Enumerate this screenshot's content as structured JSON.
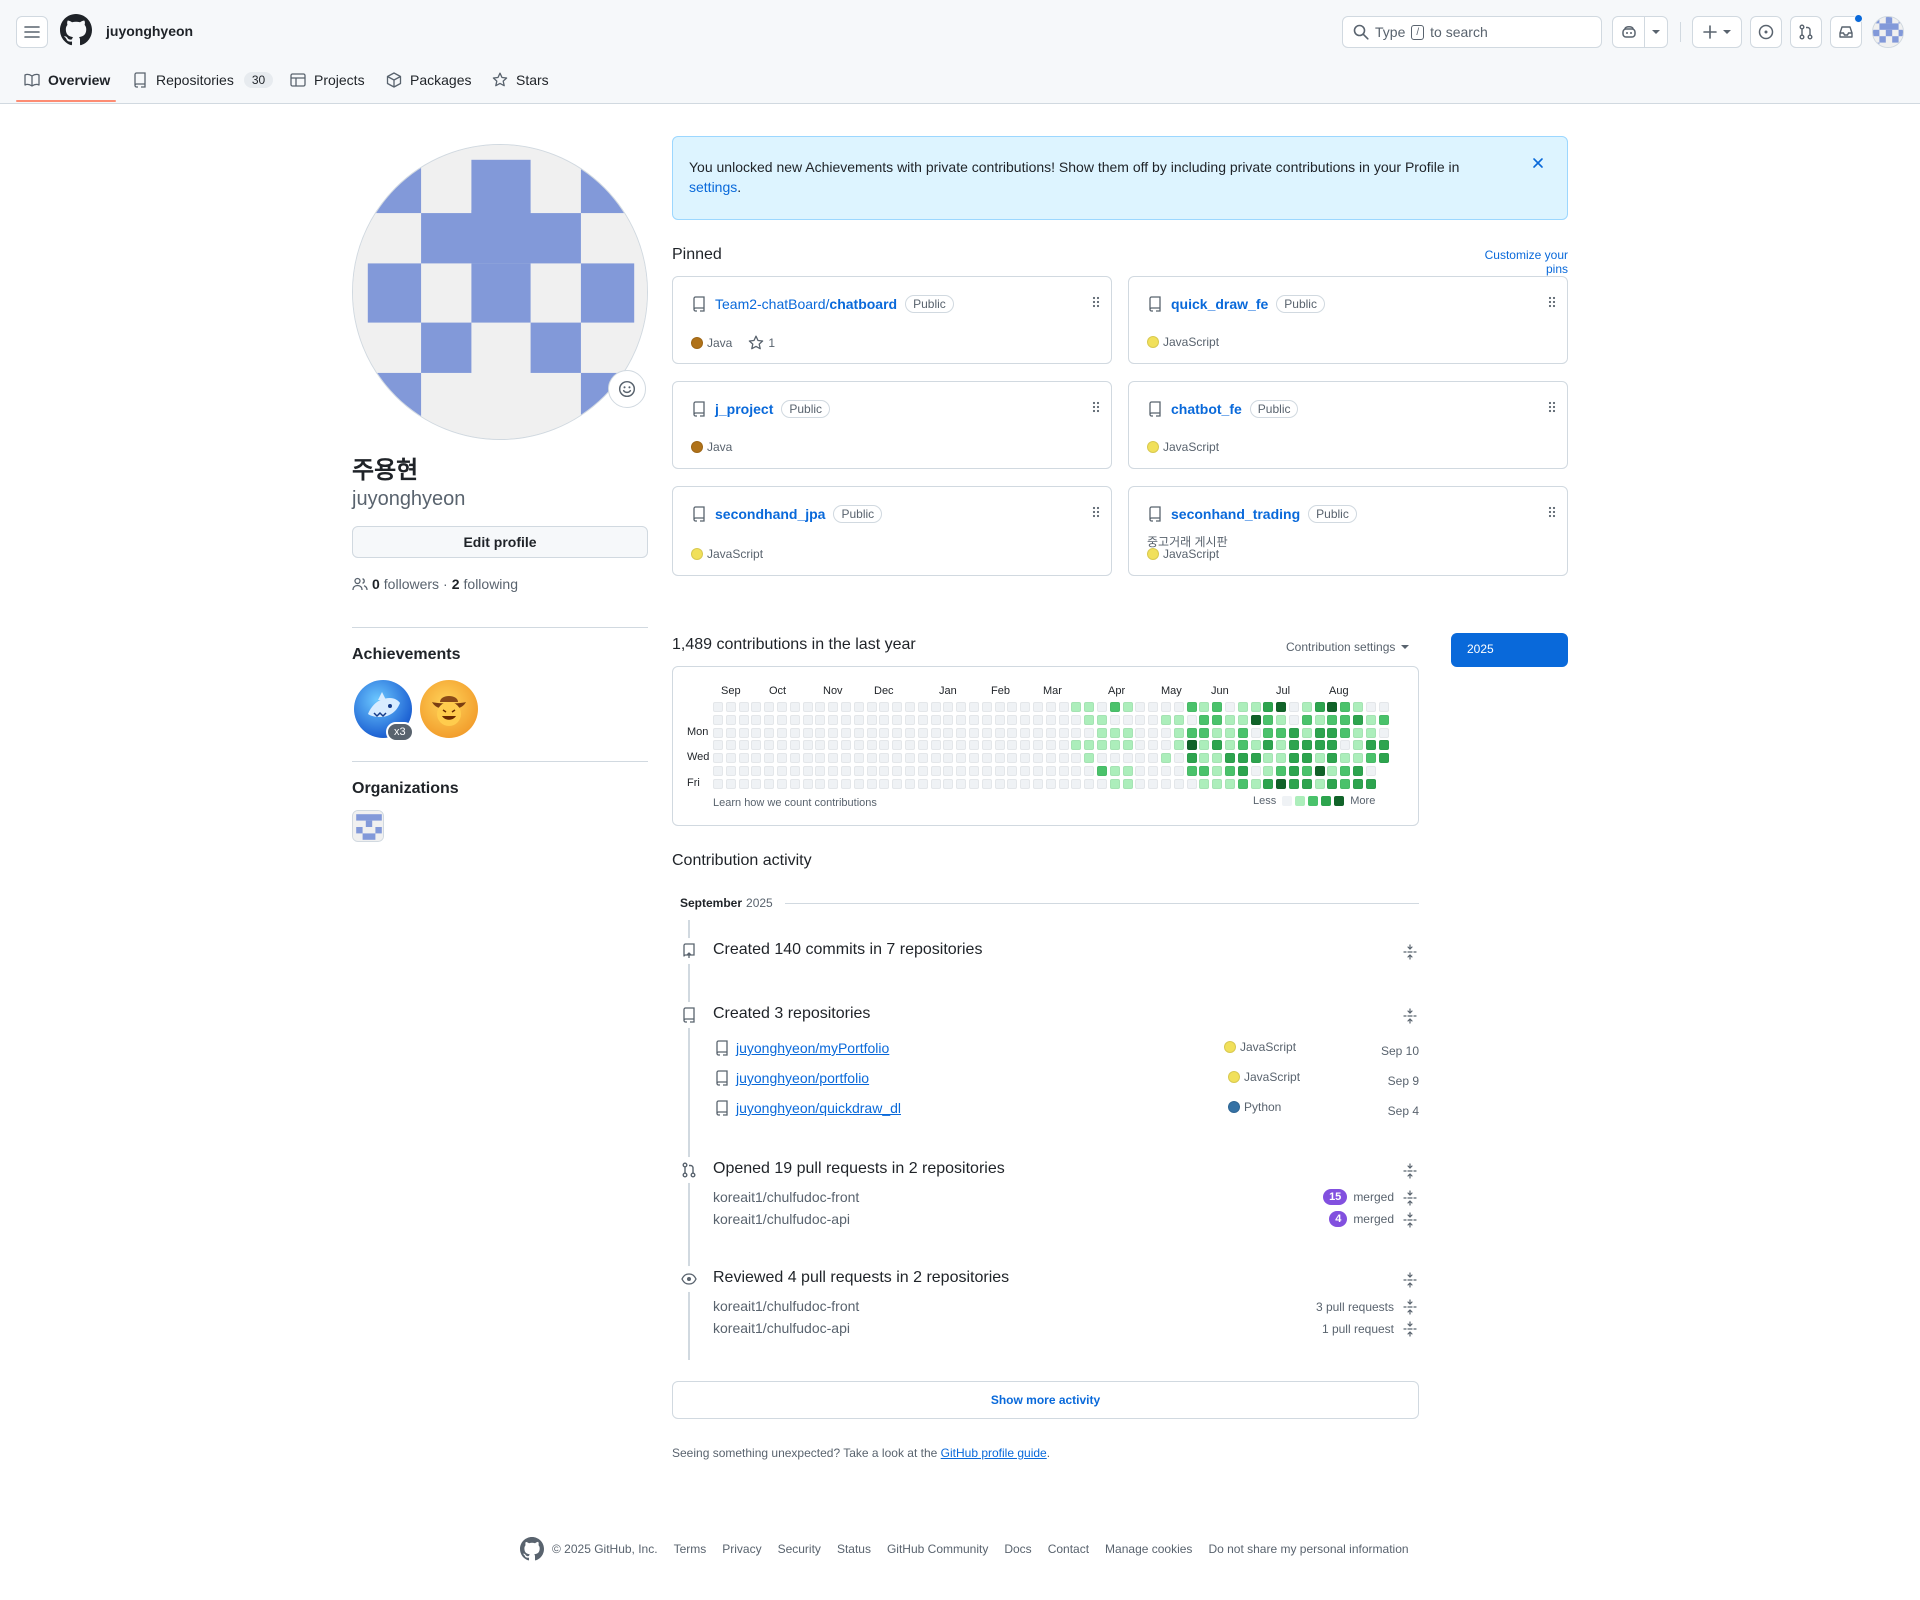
{
  "header": {
    "username": "juyonghyeon",
    "search_placeholder": "Type",
    "search_slash": "/",
    "search_suffix": "to search"
  },
  "tabs": [
    {
      "label": "Overview",
      "active": true
    },
    {
      "label": "Repositories",
      "count": "30"
    },
    {
      "label": "Projects"
    },
    {
      "label": "Packages"
    },
    {
      "label": "Stars"
    }
  ],
  "profile": {
    "display_name": "주용현",
    "username": "juyonghyeon",
    "edit_profile": "Edit profile",
    "followers_count": "0",
    "followers_label": "followers",
    "separator": "·",
    "following_count": "2",
    "following_label": "following",
    "achievements_title": "Achievements",
    "achievement_multiplier": "x3",
    "organizations_title": "Organizations",
    "avatar_color": "#8299d9"
  },
  "banner": {
    "text": "You unlocked new Achievements with private contributions! Show them off by including private contributions in your Profile in",
    "link": "settings",
    "end": "."
  },
  "pinned": {
    "title": "Pinned",
    "customize": "Customize your pins",
    "items": [
      {
        "owner": "Team2-chatBoard/",
        "name": "chatboard",
        "visibility": "Public",
        "description": "",
        "language": "Java",
        "language_color": "#b07219",
        "stars": "1"
      },
      {
        "owner": "",
        "name": "quick_draw_fe",
        "visibility": "Public",
        "description": "",
        "language": "JavaScript",
        "language_color": "#f1e05a",
        "stars": ""
      },
      {
        "owner": "",
        "name": "j_project",
        "visibility": "Public",
        "description": "",
        "language": "Java",
        "language_color": "#b07219",
        "stars": ""
      },
      {
        "owner": "",
        "name": "chatbot_fe",
        "visibility": "Public",
        "description": "",
        "language": "JavaScript",
        "language_color": "#f1e05a",
        "stars": ""
      },
      {
        "owner": "",
        "name": "secondhand_jpa",
        "visibility": "Public",
        "description": "",
        "language": "JavaScript",
        "language_color": "#f1e05a",
        "stars": ""
      },
      {
        "owner": "",
        "name": "seconhand_trading",
        "visibility": "Public",
        "description": "중고거래 게시판",
        "language": "JavaScript",
        "language_color": "#f1e05a",
        "stars": ""
      }
    ]
  },
  "contributions": {
    "title": "1,489 contributions in the last year",
    "settings_label": "Contribution settings",
    "year": "2025",
    "months": [
      "Sep",
      "Oct",
      "Nov",
      "Dec",
      "Jan",
      "Feb",
      "Mar",
      "Apr",
      "May",
      "Jun",
      "Jul",
      "Aug"
    ],
    "days": [
      "Mon",
      "Wed",
      "Fri"
    ],
    "learn_link": "Learn how we count contributions",
    "less": "Less",
    "more": "More",
    "colors": [
      "#eff2f5",
      "#aceebb",
      "#4ac26b",
      "#2da44e",
      "#116329"
    ]
  },
  "activity": {
    "title": "Contribution activity",
    "month": "September",
    "year": "2025",
    "commits_title": "Created 140 commits in 7 repositories",
    "repos_title": "Created 3 repositories",
    "created_repos": [
      {
        "name": "juyonghyeon/myPortfolio",
        "language": "JavaScript",
        "color": "#f1e05a",
        "date": "Sep 10"
      },
      {
        "name": "juyonghyeon/portfolio",
        "language": "JavaScript",
        "color": "#f1e05a",
        "date": "Sep 9"
      },
      {
        "name": "juyonghyeon/quickdraw_dl",
        "language": "Python",
        "color": "#3572A5",
        "date": "Sep 4"
      }
    ],
    "prs_title": "Opened 19 pull requests in 2 repositories",
    "prs": [
      {
        "repo": "koreait1/chulfudoc-front",
        "count": "15",
        "state": "merged"
      },
      {
        "repo": "koreait1/chulfudoc-api",
        "count": "4",
        "state": "merged"
      }
    ],
    "reviews_title": "Reviewed 4 pull requests in 2 repositories",
    "reviews": [
      {
        "repo": "koreait1/chulfudoc-front",
        "count": "3 pull requests"
      },
      {
        "repo": "koreait1/chulfudoc-api",
        "count": "1 pull request"
      }
    ],
    "show_more": "Show more activity",
    "unexpected": "Seeing something unexpected? Take a look at the",
    "guide_link": "GitHub profile guide",
    "guide_end": "."
  },
  "footer": {
    "copyright": "© 2025 GitHub, Inc.",
    "links": [
      "Terms",
      "Privacy",
      "Security",
      "Status",
      "GitHub Community",
      "Docs",
      "Contact",
      "Manage cookies",
      "Do not share my personal information"
    ]
  }
}
